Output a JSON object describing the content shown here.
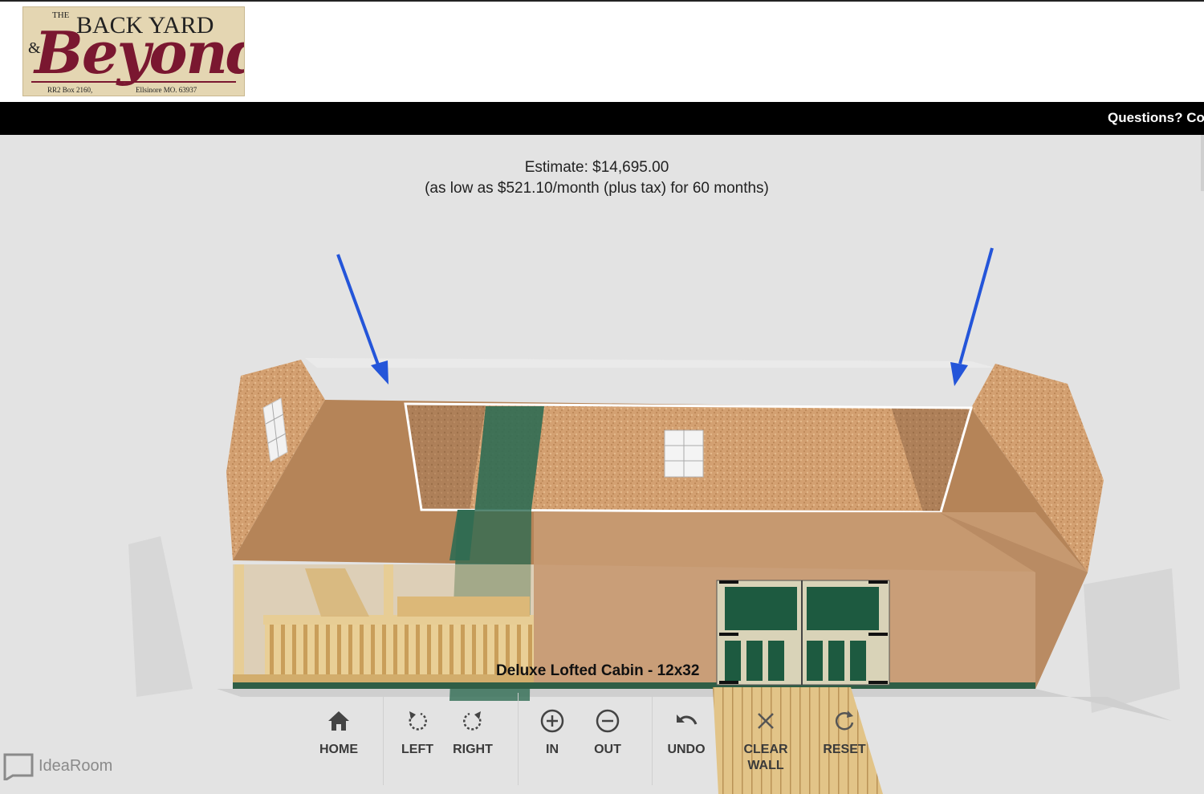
{
  "logo": {
    "the": "THE",
    "back_yard": "BACK YARD",
    "ampersand": "&",
    "beyond": "Beyond",
    "address_left": "RR2 Box 2160,",
    "address_right": "Ellsinore MO. 63937"
  },
  "topbar": {
    "questions": "Questions? Con"
  },
  "estimate": {
    "line1": "Estimate: $14,695.00",
    "line2": "(as low as $521.10/month (plus tax) for 60 months)"
  },
  "model": {
    "name": "Deluxe Lofted Cabin - 12x32"
  },
  "toolbar": {
    "home": "HOME",
    "left": "LEFT",
    "right": "RIGHT",
    "in": "IN",
    "out": "OUT",
    "undo": "UNDO",
    "clear_wall_1": "CLEAR",
    "clear_wall_2": "WALL",
    "reset": "RESET"
  },
  "branding": {
    "idearoom": "IdeaRoom"
  },
  "colors": {
    "header_bar": "#000000",
    "viewer_bg": "#e3e3e3",
    "logo_bg": "#e4d6b2",
    "logo_text": "#7a1730",
    "annotation_arrow": "#2455d9",
    "trim_green": "#1f5a44",
    "wood_siding": "#c59066"
  },
  "icons": {
    "home": "home-icon",
    "left": "rotate-left-icon",
    "right": "rotate-right-icon",
    "in": "zoom-in-icon",
    "out": "zoom-out-icon",
    "undo": "undo-icon",
    "clear_wall": "close-icon",
    "reset": "reset-icon"
  }
}
